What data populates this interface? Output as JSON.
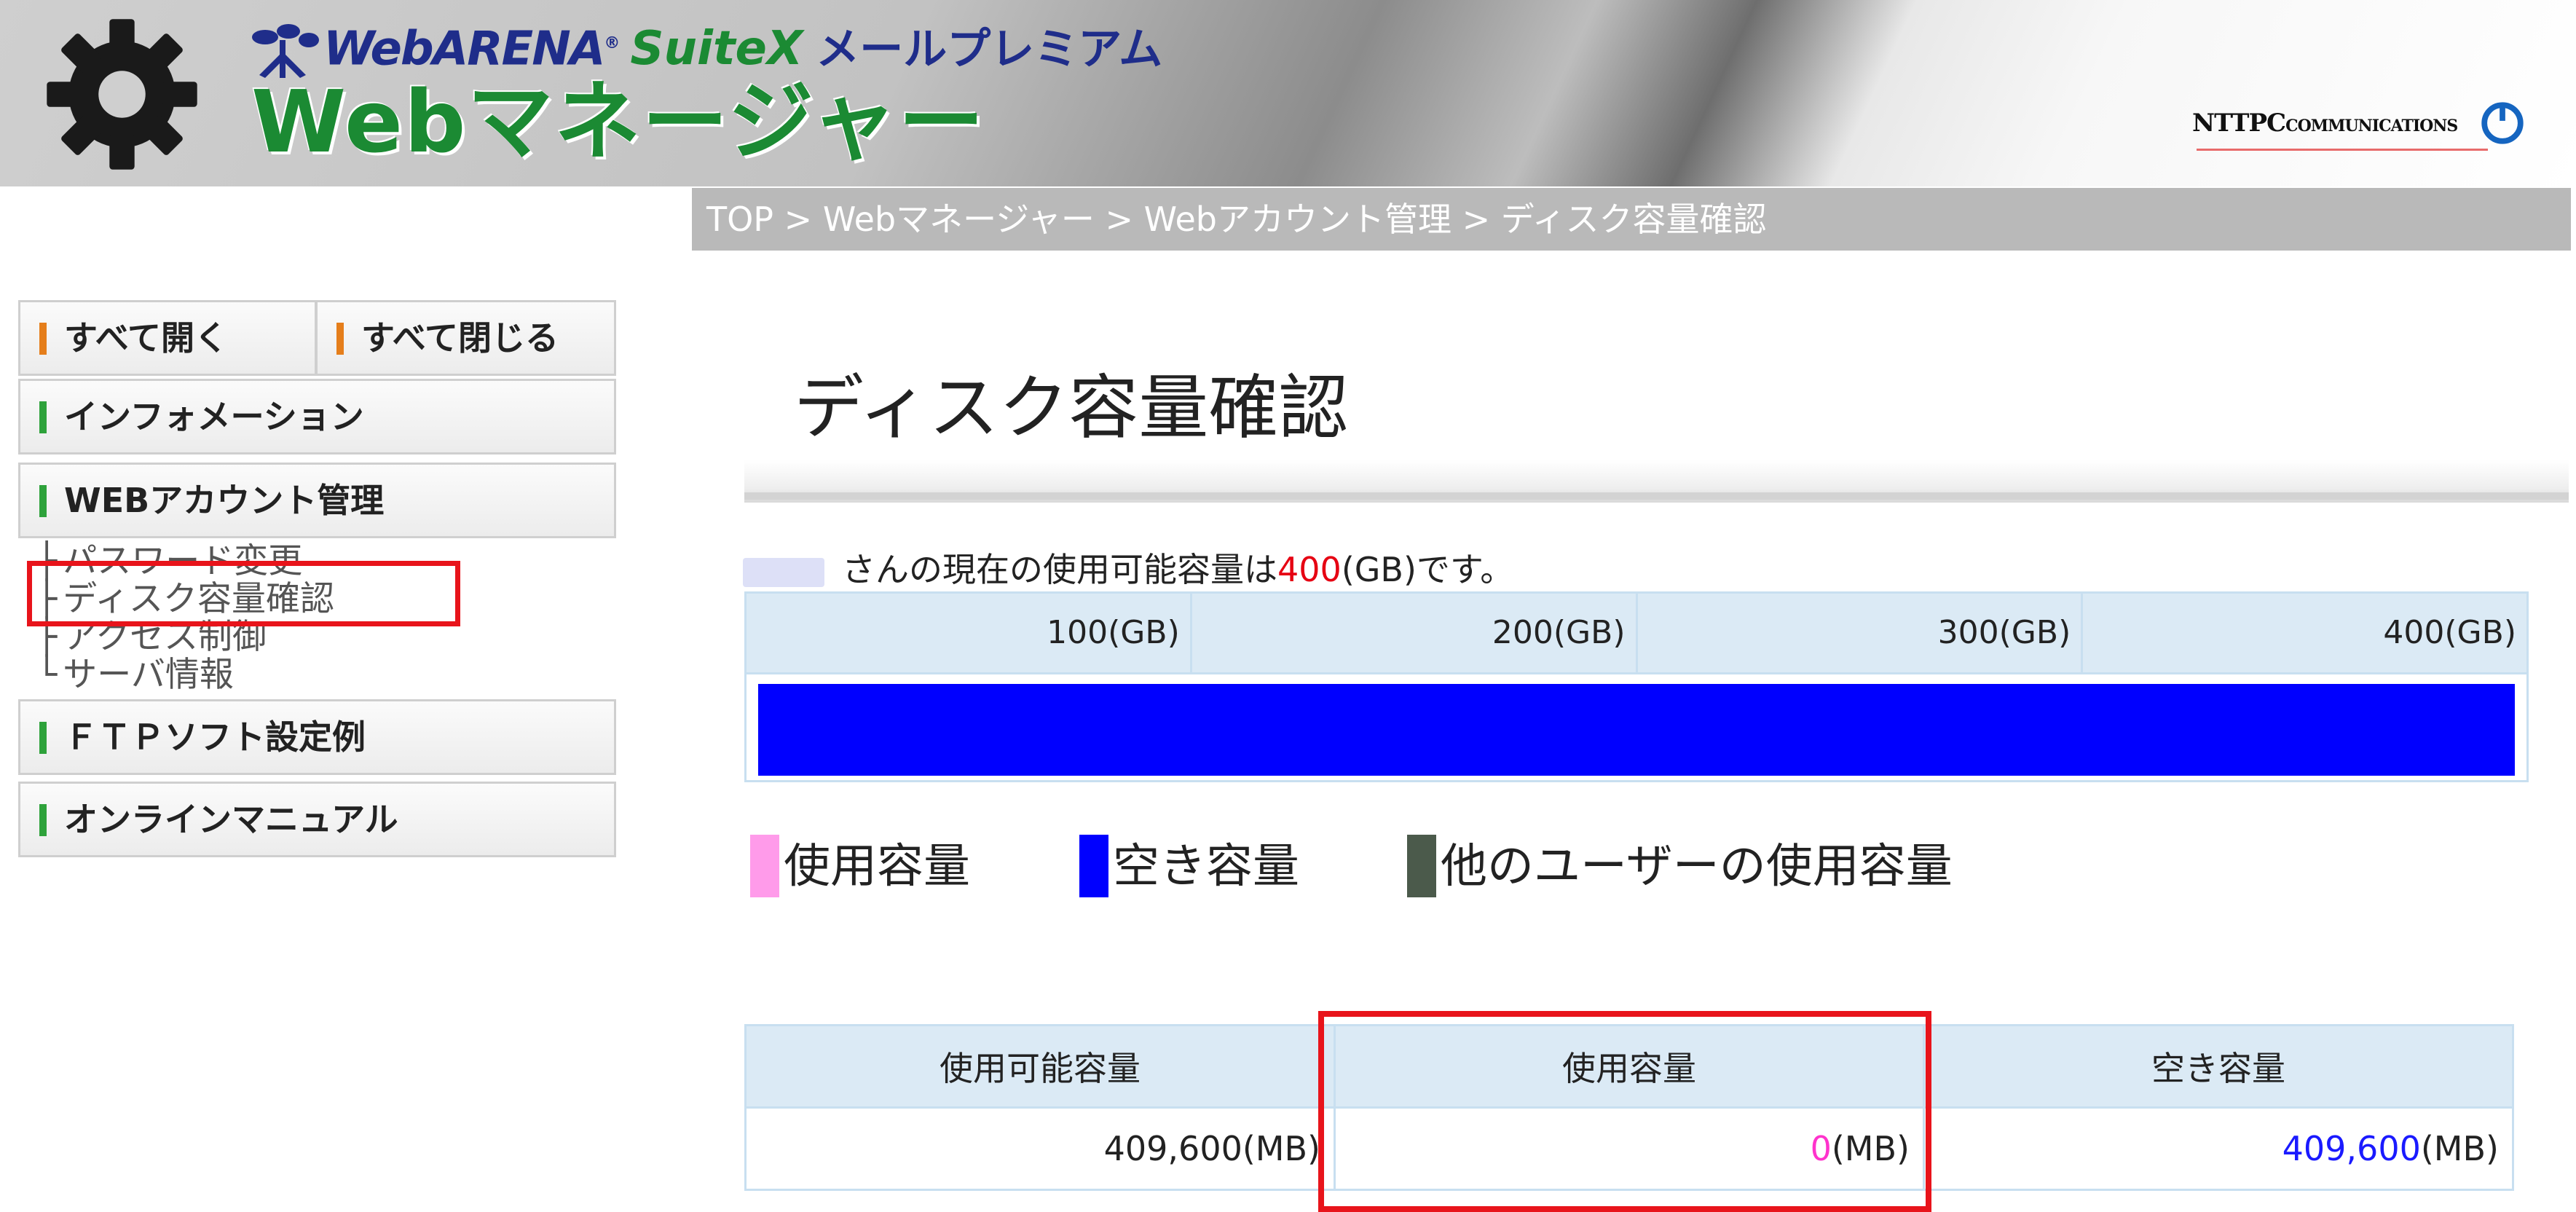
{
  "header": {
    "brand": {
      "webarena": "WebARENA",
      "registered": "®",
      "suitex": "SuiteX",
      "product": "メールプレミアム"
    },
    "app_title": "Webマネージャー",
    "corporate_logo": {
      "ntt": "NTT",
      "pc": "PC",
      "communications": "COMMUNICATIONS"
    }
  },
  "breadcrumb": {
    "text": "TOP > Webマネージャー > Webアカウント管理 > ディスク容量確認",
    "items": [
      "TOP",
      "Webマネージャー",
      "Webアカウント管理",
      "ディスク容量確認"
    ]
  },
  "sidebar": {
    "expand_all": "すべて開く",
    "collapse_all": "すべて閉じる",
    "sections": [
      {
        "label": "インフォメーション"
      },
      {
        "label": "WEBアカウント管理",
        "items": [
          "パスワード変更",
          "ディスク容量確認",
          "アクセス制御",
          "サーバ情報"
        ]
      },
      {
        "label": "ＦＴＰソフト設定例"
      },
      {
        "label": "オンラインマニュアル"
      }
    ],
    "tree_glyphs": [
      "├",
      "├",
      "├",
      "└"
    ]
  },
  "main": {
    "title": "ディスク容量確認",
    "sentence_prefix": "さんの現在の使用可能容量は",
    "capacity_value": "400",
    "sentence_suffix": "(GB)です。",
    "scale_labels": [
      "100(GB)",
      "200(GB)",
      "300(GB)",
      "400(GB)"
    ],
    "usage": {
      "used_fraction": 0.0,
      "free_fraction": 1.0
    },
    "legend": {
      "used": "使用容量",
      "free": "空き容量",
      "others": "他のユーザーの使用容量"
    },
    "summary": {
      "headers": [
        "使用可能容量",
        "使用容量",
        "空き容量"
      ],
      "available_value": "409,600",
      "used_value": "0",
      "free_value": "409,600",
      "unit": "(MB)"
    }
  },
  "colors": {
    "brand_green": "#1b8a33",
    "brand_navy": "#1f2d8a",
    "used": "#ff9bea",
    "free": "#0000ff",
    "others": "#4b5a4b",
    "highlight": "#e8141b",
    "capacity_red": "#e60012"
  }
}
